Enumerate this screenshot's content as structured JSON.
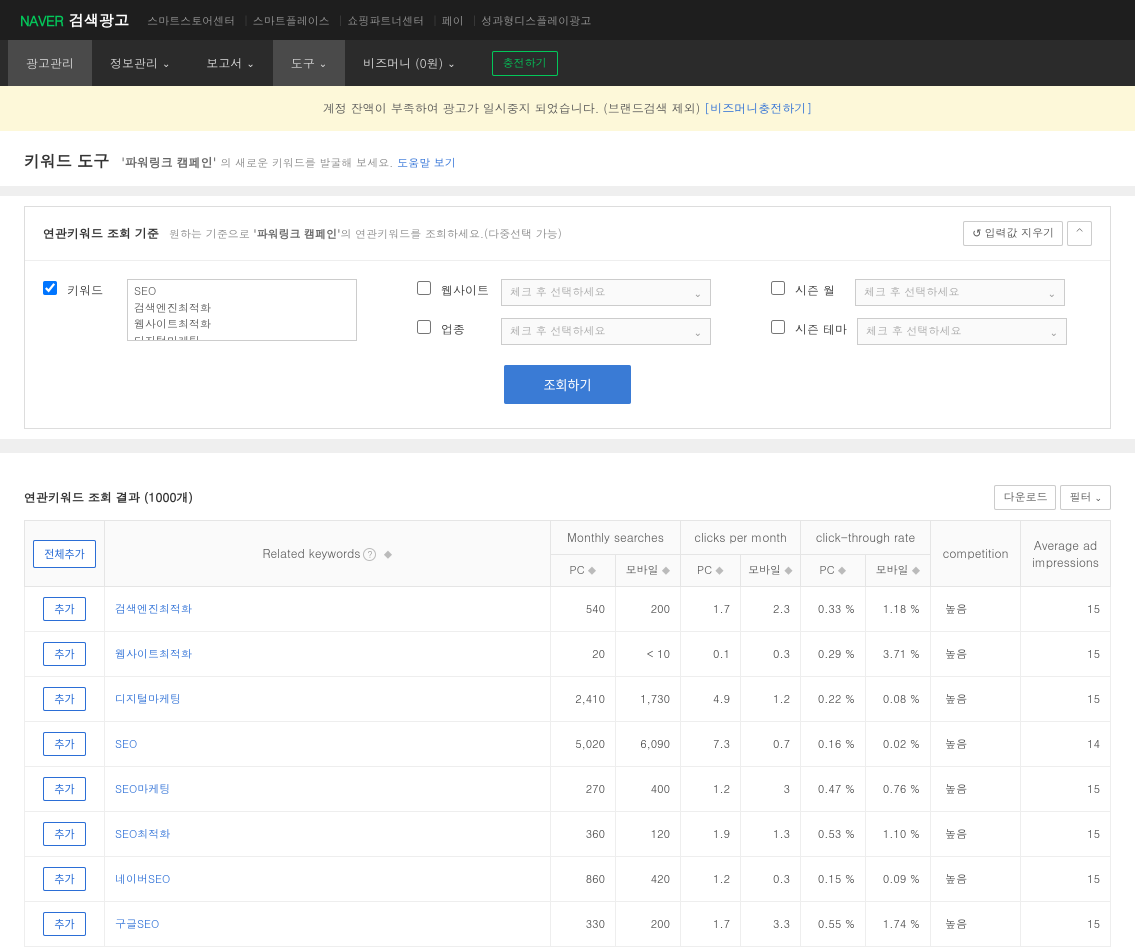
{
  "topbar": {
    "logo_naver": "NAVER",
    "logo_text": "검색광고",
    "links": [
      "스마트스토어센터",
      "스마트플레이스",
      "쇼핑파트너센터",
      "페이",
      "성과형디스플레이광고"
    ]
  },
  "nav": {
    "items": [
      {
        "label": "광고관리",
        "caret": false,
        "active": true
      },
      {
        "label": "정보관리",
        "caret": true
      },
      {
        "label": "보고서",
        "caret": true
      },
      {
        "label": "도구",
        "caret": true,
        "hl": true
      },
      {
        "label": "비즈머니 (0원)",
        "caret": true
      }
    ],
    "charge": "충전하기"
  },
  "notice": {
    "text": "계정 잔액이 부족하여 광고가 일시중지 되었습니다. (브랜드검색 제외)",
    "link": "[비즈머니충전하기]"
  },
  "page": {
    "title": "키워드 도구",
    "campaign": "'파워링크 캠페인'",
    "sub": "의 새로운 키워드를 발굴해 보세요.",
    "help": "도움말 보기"
  },
  "criteria": {
    "title": "연관키워드 조회 기준",
    "sub1": "원하는 기준으로 ",
    "emph": "'파워링크 캠페인'",
    "sub2": "의 연관키워드를 조회하세요.(다중선택 가능)",
    "reset": "입력값 지우기",
    "collapse": "^",
    "kw_label": "키워드",
    "kw_value": "SEO\n검색엔진최적화\n웹사이트최적화\n디지털마케팅",
    "website_label": "웹사이트",
    "industry_label": "업종",
    "season_month_label": "시즌 월",
    "season_theme_label": "시즌 테마",
    "placeholder": "체크 후 선택하세요",
    "search_btn": "조회하기"
  },
  "results": {
    "title": "연관키워드 조회 결과 (1000개)",
    "download": "다운로드",
    "filter": "필터",
    "addall": "전체추가",
    "add": "추가",
    "headers": {
      "related": "Related keywords",
      "monthly": "Monthly searches",
      "clicks": "clicks per month",
      "ctr": "click-through rate",
      "pc": "PC",
      "mobile": "모바일",
      "competition": "competition",
      "avg_imp": "Average ad impressions"
    },
    "rows": [
      {
        "kw": "검색엔진최적화",
        "mpc": "540",
        "mmob": "200",
        "cpc": "1.7",
        "cmob": "2.3",
        "ctrpc": "0.33 %",
        "ctrmob": "1.18 %",
        "comp": "높음",
        "avg": "15"
      },
      {
        "kw": "웹사이트최적화",
        "mpc": "20",
        "mmob": "< 10",
        "cpc": "0.1",
        "cmob": "0.3",
        "ctrpc": "0.29 %",
        "ctrmob": "3.71 %",
        "comp": "높음",
        "avg": "15"
      },
      {
        "kw": "디지털마케팅",
        "mpc": "2,410",
        "mmob": "1,730",
        "cpc": "4.9",
        "cmob": "1.2",
        "ctrpc": "0.22 %",
        "ctrmob": "0.08 %",
        "comp": "높음",
        "avg": "15"
      },
      {
        "kw": "SEO",
        "mpc": "5,020",
        "mmob": "6,090",
        "cpc": "7.3",
        "cmob": "0.7",
        "ctrpc": "0.16 %",
        "ctrmob": "0.02 %",
        "comp": "높음",
        "avg": "14"
      },
      {
        "kw": "SEO마케팅",
        "mpc": "270",
        "mmob": "400",
        "cpc": "1.2",
        "cmob": "3",
        "ctrpc": "0.47 %",
        "ctrmob": "0.76 %",
        "comp": "높음",
        "avg": "15"
      },
      {
        "kw": "SEO최적화",
        "mpc": "360",
        "mmob": "120",
        "cpc": "1.9",
        "cmob": "1.3",
        "ctrpc": "0.53 %",
        "ctrmob": "1.10 %",
        "comp": "높음",
        "avg": "15"
      },
      {
        "kw": "네이버SEO",
        "mpc": "860",
        "mmob": "420",
        "cpc": "1.2",
        "cmob": "0.3",
        "ctrpc": "0.15 %",
        "ctrmob": "0.09 %",
        "comp": "높음",
        "avg": "15"
      },
      {
        "kw": "구글SEO",
        "mpc": "330",
        "mmob": "200",
        "cpc": "1.7",
        "cmob": "3.3",
        "ctrpc": "0.55 %",
        "ctrmob": "1.74 %",
        "comp": "높음",
        "avg": "15"
      }
    ]
  }
}
